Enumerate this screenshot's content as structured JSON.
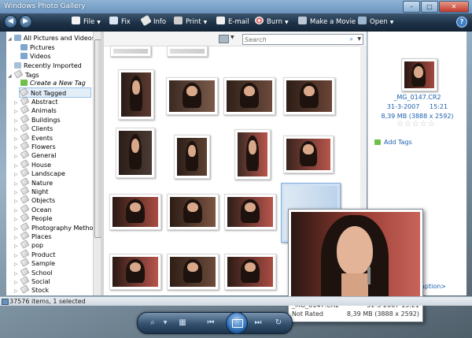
{
  "window": {
    "title": "Windows Photo Gallery",
    "minimize": "–",
    "maximize": "□",
    "close": "✕"
  },
  "toolbar": {
    "back": "◀",
    "forward": "▶",
    "items": [
      {
        "label": "File",
        "icon": "file-icon",
        "arrow": "▼"
      },
      {
        "label": "Fix",
        "icon": "fix-icon"
      },
      {
        "label": "Info",
        "icon": "info-icon"
      },
      {
        "label": "Print",
        "icon": "printer-icon",
        "arrow": "▼"
      },
      {
        "label": "E-mail",
        "icon": "email-icon"
      },
      {
        "label": "Burn",
        "icon": "burn-disc-icon",
        "arrow": "▼"
      },
      {
        "label": "Make a Movie",
        "icon": "movie-icon"
      },
      {
        "label": "Open",
        "icon": "open-icon",
        "arrow": "▼"
      }
    ],
    "help": "?"
  },
  "nav": {
    "all": "All Pictures and Videos",
    "pictures": "Pictures",
    "videos": "Videos",
    "recent": "Recently Imported",
    "tags": "Tags",
    "create_tag": "Create a New Tag",
    "not_tagged": "Not Tagged",
    "tag_items": [
      "Abstract",
      "Animals",
      "Buildings",
      "Clients",
      "Events",
      "Flowers",
      "General",
      "House",
      "Landscape",
      "Nature",
      "Night",
      "Objects",
      "Ocean",
      "People",
      "Photography Methods",
      "Places",
      "pop",
      "Product",
      "Sample",
      "School",
      "Social",
      "Stock"
    ]
  },
  "search": {
    "placeholder": "Search"
  },
  "info": {
    "filename": "_MG_0147.CR2",
    "date": "31-3-2007",
    "time": "15:21",
    "size": "8,39 MB (3888 x 2592)",
    "stars": "☆☆☆☆☆",
    "add_tags": "Add Tags",
    "caption": "aption>"
  },
  "popup": {
    "filename": "_MG_0147.CR2",
    "datetime": "31-3-2007 15:21",
    "rating": "Not Rated",
    "size": "8,39 MB (3888 x 2592)"
  },
  "status": {
    "text": "37576 items, 1 selected"
  },
  "colors": {
    "accent": "#1b5fae",
    "toolbar": "#1e3247",
    "photo_red": "#b7554c"
  }
}
